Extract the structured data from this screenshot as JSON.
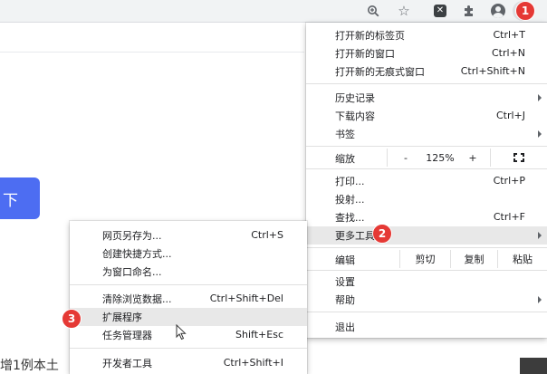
{
  "toolbar": {
    "icons": [
      "zoom-icon",
      "star-icon",
      "extension-x-icon",
      "puzzle-icon",
      "profile-icon",
      "kebab-menu-icon"
    ]
  },
  "page": {
    "button_label": "下",
    "bottom_text": "增1例本土"
  },
  "main_menu": {
    "new_tab": {
      "label": "打开新的标签页",
      "shortcut": "Ctrl+T"
    },
    "new_window": {
      "label": "打开新的窗口",
      "shortcut": "Ctrl+N"
    },
    "new_incognito": {
      "label": "打开新的无痕式窗口",
      "shortcut": "Ctrl+Shift+N"
    },
    "history": {
      "label": "历史记录"
    },
    "downloads": {
      "label": "下载内容",
      "shortcut": "Ctrl+J"
    },
    "bookmarks": {
      "label": "书签"
    },
    "zoom": {
      "label": "缩放",
      "minus": "-",
      "value": "125%",
      "plus": "+"
    },
    "print": {
      "label": "打印...",
      "shortcut": "Ctrl+P"
    },
    "cast": {
      "label": "投射..."
    },
    "find": {
      "label": "查找...",
      "shortcut": "Ctrl+F"
    },
    "more_tools": {
      "label": "更多工具"
    },
    "edit": {
      "label": "编辑",
      "cut": "剪切",
      "copy": "复制",
      "paste": "粘贴"
    },
    "settings": {
      "label": "设置"
    },
    "help": {
      "label": "帮助"
    },
    "exit": {
      "label": "退出"
    }
  },
  "sub_menu": {
    "save_page": {
      "label": "网页另存为...",
      "shortcut": "Ctrl+S"
    },
    "create_shortcut": {
      "label": "创建快捷方式..."
    },
    "name_window": {
      "label": "为窗口命名..."
    },
    "clear_data": {
      "label": "清除浏览数据...",
      "shortcut": "Ctrl+Shift+Del"
    },
    "extensions": {
      "label": "扩展程序"
    },
    "task_manager": {
      "label": "任务管理器",
      "shortcut": "Shift+Esc"
    },
    "dev_tools": {
      "label": "开发者工具",
      "shortcut": "Ctrl+Shift+I"
    }
  },
  "badges": [
    "1",
    "2",
    "3"
  ],
  "colors": {
    "badge": "#e53935",
    "button": "#4d6df2",
    "highlight": "#e8e8e8"
  }
}
